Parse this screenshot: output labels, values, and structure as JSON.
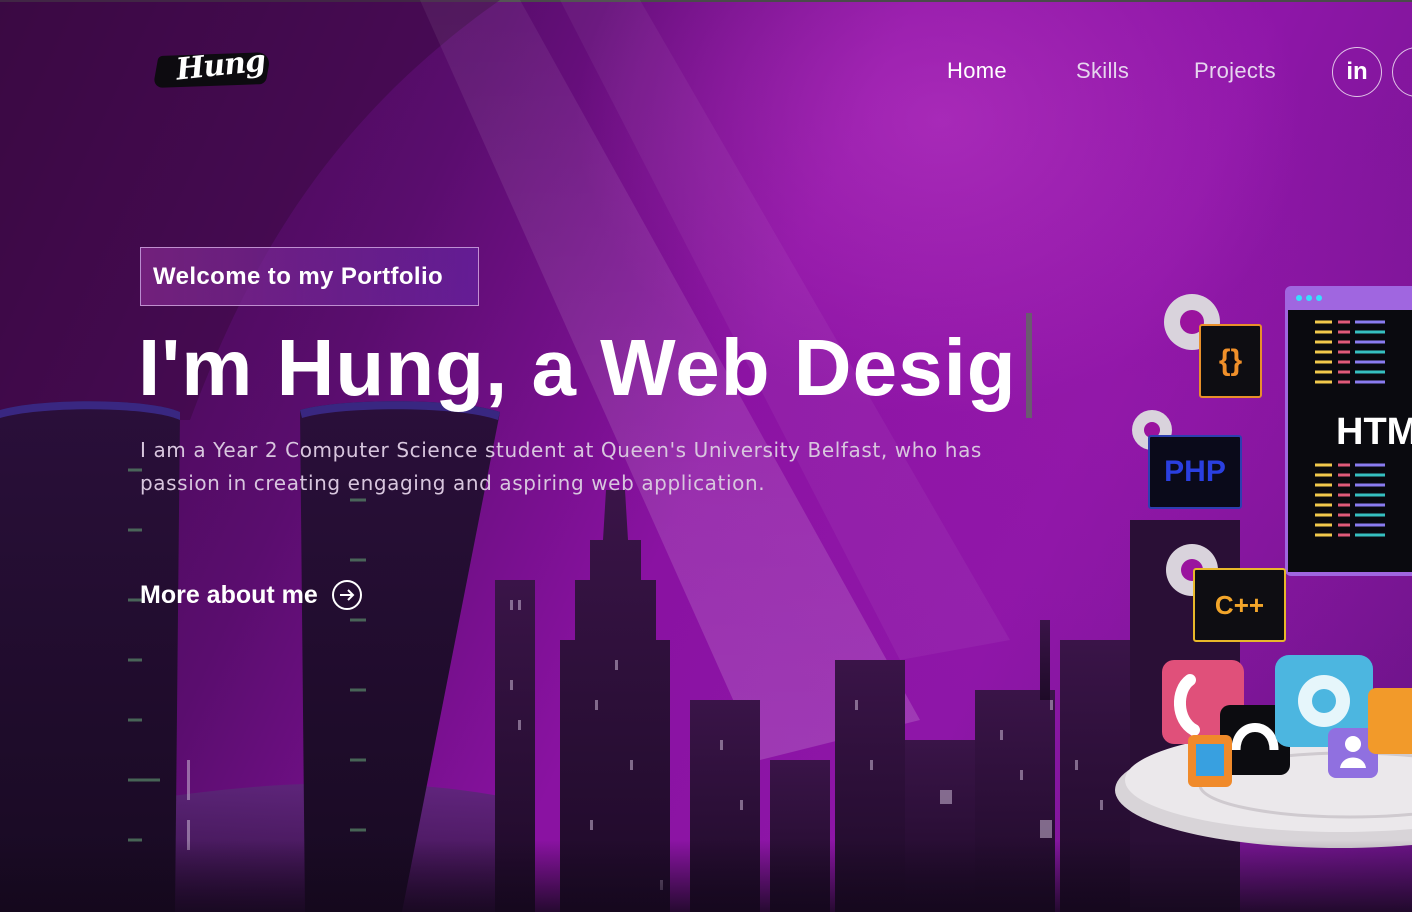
{
  "header": {
    "logo_text": "Hung",
    "nav": [
      {
        "label": "Home"
      },
      {
        "label": "Skills"
      },
      {
        "label": "Projects"
      }
    ],
    "social": [
      {
        "label": "in",
        "icon": "linkedin-icon"
      },
      {
        "label": "",
        "icon": "social-icon"
      }
    ]
  },
  "hero": {
    "tagline": "Welcome to my Portfolio",
    "title": "I'm Hung, a Web Desig",
    "description": "I am a Year 2 Computer Science student at Queen's University Belfast, who has passion in creating engaging and aspiring web application.",
    "cta_label": "More about me"
  },
  "illustration": {
    "code_tile": "{}",
    "php_tile": "PHP",
    "cpp_tile": "C++",
    "html_panel": "HTML"
  },
  "colors": {
    "background_accent": "#8e16a8",
    "text_primary": "#ffffff",
    "text_secondary": "#d8c6de"
  }
}
